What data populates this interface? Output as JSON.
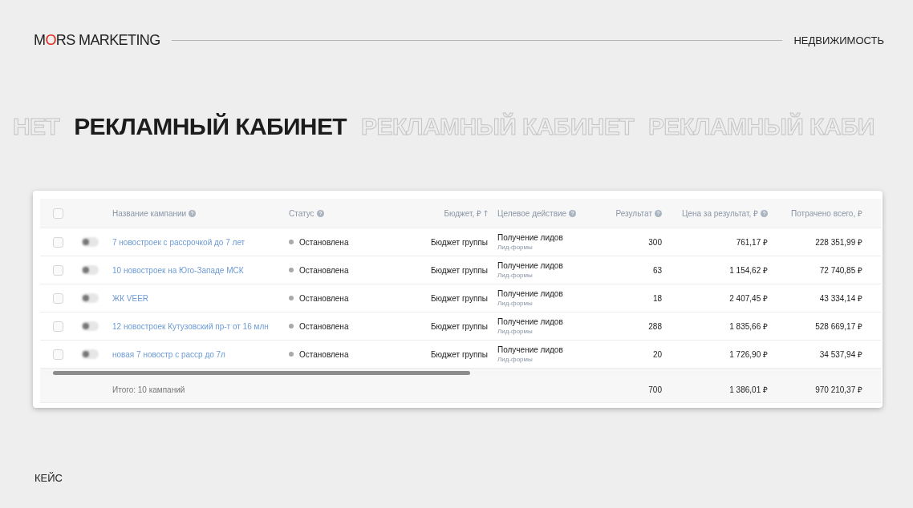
{
  "header": {
    "logo": [
      {
        "text": "M",
        "accent": false
      },
      {
        "text": "O",
        "accent": true
      },
      {
        "text": "RS MARKETING",
        "accent": false
      }
    ],
    "category": "НЕДВИЖИМОСТЬ"
  },
  "banner": [
    {
      "text": "НЕТ",
      "kind": "ghost"
    },
    {
      "text": "РЕКЛАМНЫЙ КАБИНЕТ",
      "kind": "solid"
    },
    {
      "text": "РЕКЛАМНЫЙ КАБИНЕТ",
      "kind": "ghost"
    },
    {
      "text": "РЕКЛАМНЫЙ КАБИ",
      "kind": "ghost"
    }
  ],
  "table": {
    "header_checked": false,
    "columns": [
      {
        "label": "Название кампании",
        "help": true,
        "sorted": false
      },
      {
        "label": "Статус",
        "help": true,
        "sorted": false
      },
      {
        "label": "Бюджет, ₽",
        "help": false,
        "sorted": true
      },
      {
        "label": "Целевое действие",
        "help": true,
        "sorted": false
      },
      {
        "label": "Результат",
        "help": true,
        "sorted": false
      },
      {
        "label": "Цена за результат, ₽",
        "help": true,
        "sorted": false
      },
      {
        "label": "Потрачено всего, ₽",
        "help": false,
        "sorted": false
      }
    ],
    "rows": [
      {
        "checked": false,
        "enabled": false,
        "name": "7 новостроек с рассрочкой до 7 лет",
        "status": "Остановлена",
        "budget": "Бюджет группы",
        "action": "Получение лидов",
        "action_sub": "Лид-формы",
        "result": "300",
        "price": "761,17 ₽",
        "spent": "228 351,99 ₽"
      },
      {
        "checked": false,
        "enabled": false,
        "name": "10 новостроек на Юго-Западе МСК",
        "status": "Остановлена",
        "budget": "Бюджет группы",
        "action": "Получение лидов",
        "action_sub": "Лид-формы",
        "result": "63",
        "price": "1 154,62 ₽",
        "spent": "72 740,85 ₽"
      },
      {
        "checked": false,
        "enabled": false,
        "name": "ЖК VEER",
        "status": "Остановлена",
        "budget": "Бюджет группы",
        "action": "Получение лидов",
        "action_sub": "Лид-формы",
        "result": "18",
        "price": "2 407,45 ₽",
        "spent": "43 334,14 ₽"
      },
      {
        "checked": false,
        "enabled": false,
        "name": "12 новостроек Кутузовский пр-т от 16 млн",
        "status": "Остановлена",
        "budget": "Бюджет группы",
        "action": "Получение лидов",
        "action_sub": "Лид-формы",
        "result": "288",
        "price": "1 835,66 ₽",
        "spent": "528 669,17 ₽"
      },
      {
        "checked": false,
        "enabled": false,
        "name": "новая 7 новостр с расср до 7л",
        "status": "Остановлена",
        "budget": "Бюджет группы",
        "action": "Получение лидов",
        "action_sub": "Лид-формы",
        "result": "20",
        "price": "1 726,90 ₽",
        "spent": "34 537,94 ₽"
      }
    ],
    "footer": {
      "label": "Итого: 10 кампаний",
      "result": "700",
      "price": "1 386,01 ₽",
      "spent": "970 210,37 ₽"
    }
  },
  "caption": "КЕЙС"
}
